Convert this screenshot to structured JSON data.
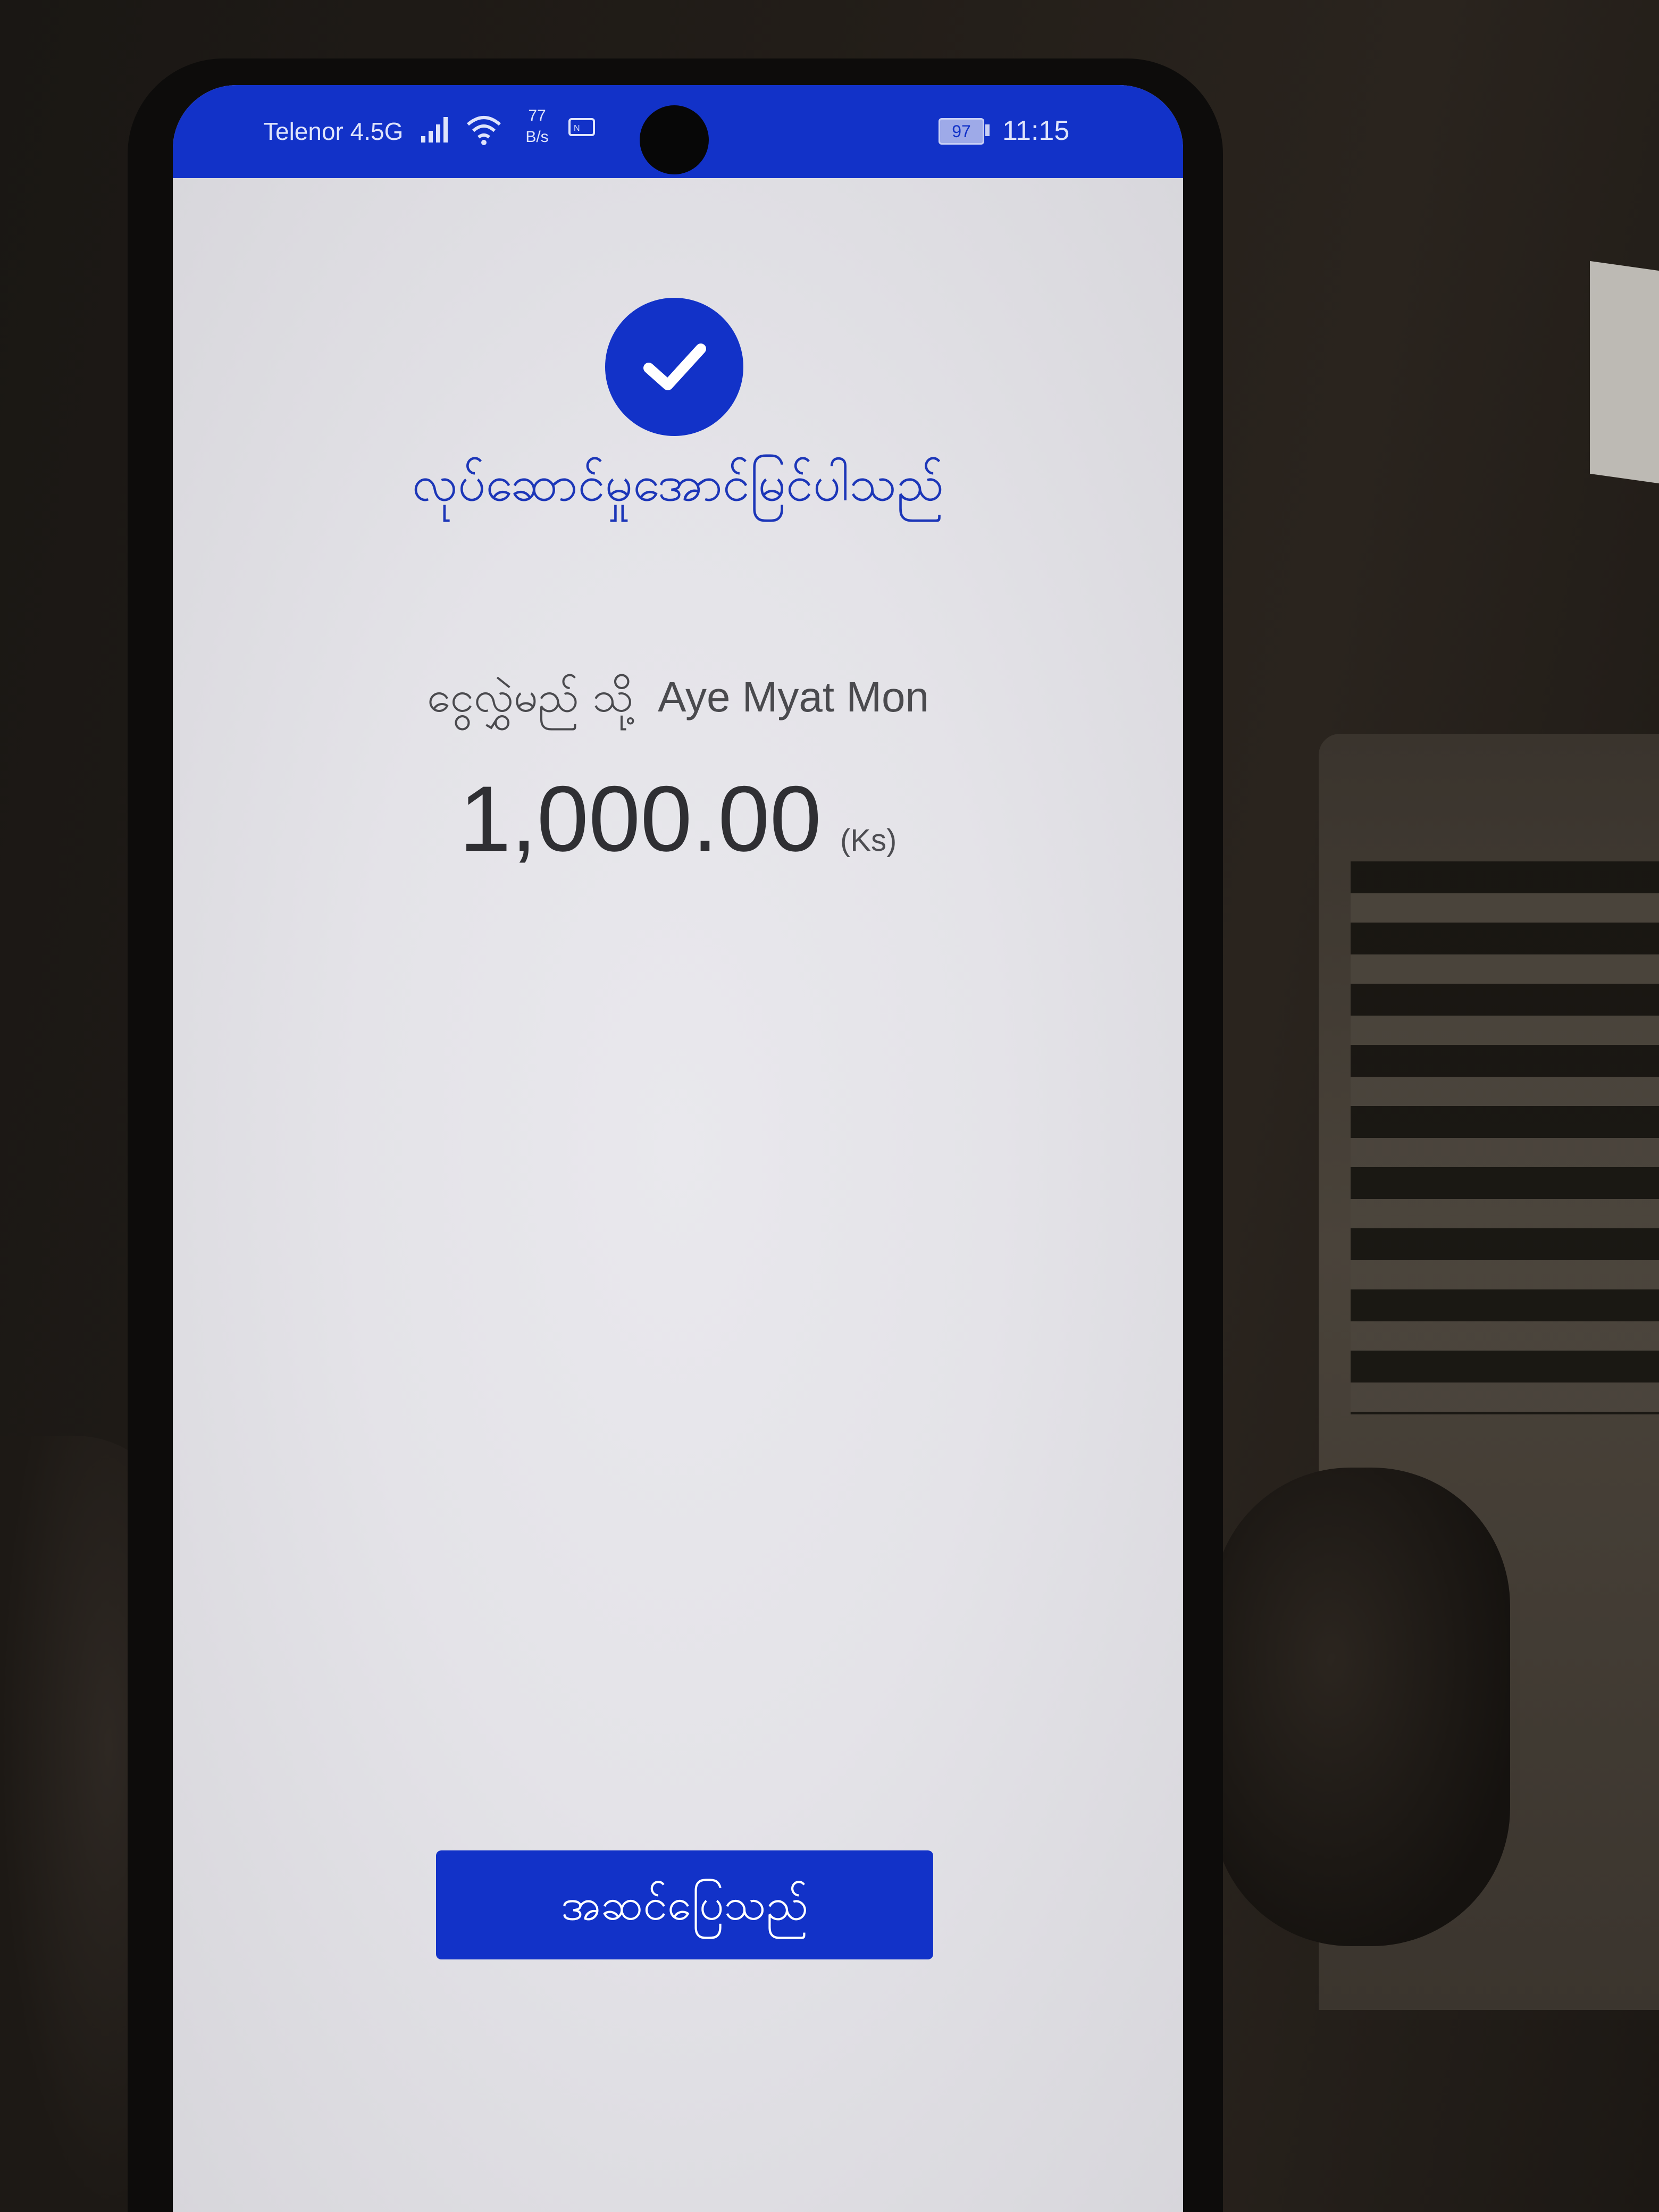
{
  "status_bar": {
    "carrier": "Telenor 4.5G",
    "net_speed_value": "77",
    "net_speed_unit": "B/s",
    "battery": "97",
    "time": "11:15",
    "bar_color": "#1232c8"
  },
  "result": {
    "icon": "check-circle-icon",
    "title": "လုပ်ဆောင်မှုအောင်မြင်ပါသည်",
    "recipient_prefix": "ငွေလွှဲမည် သို့",
    "recipient_name": "Aye Myat Mon",
    "amount": "1,000.00",
    "currency": "(Ks)"
  },
  "actions": {
    "done_label": "အဆင်ပြေသည်"
  },
  "colors": {
    "accent": "#1232c8",
    "screen_bg": "#e6e5ea",
    "text": "#2f2f33"
  }
}
